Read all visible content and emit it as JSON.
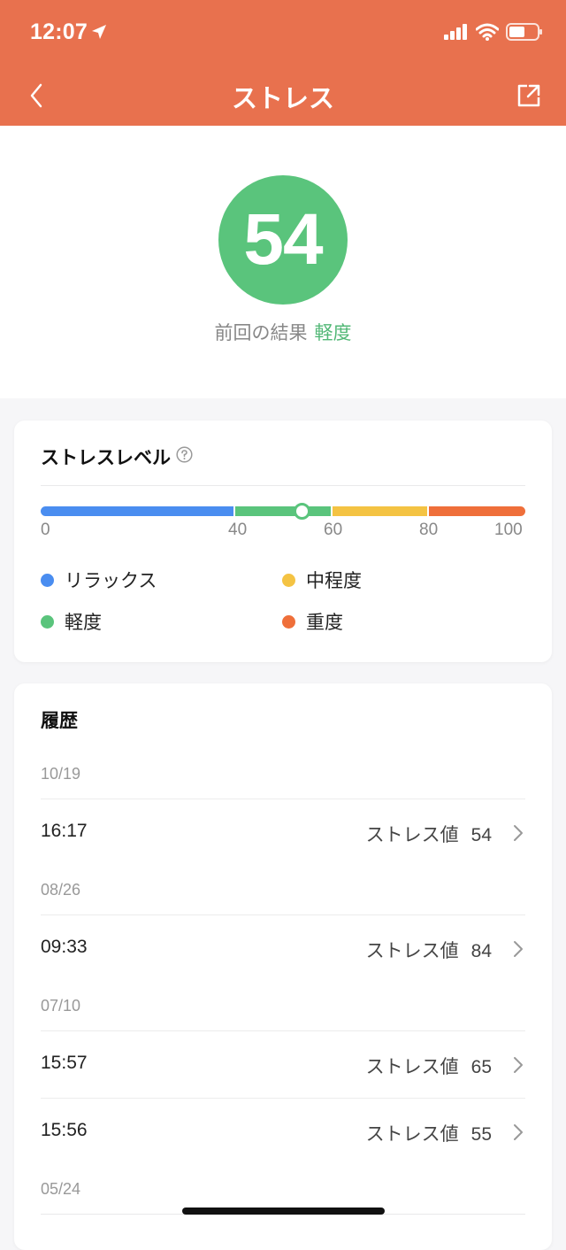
{
  "status_bar": {
    "time": "12:07"
  },
  "nav": {
    "title": "ストレス"
  },
  "summary": {
    "score": "54",
    "result_label": "前回の結果",
    "result_value": "軽度"
  },
  "stress_level": {
    "title": "ストレスレベル",
    "ticks": [
      "0",
      "40",
      "60",
      "80",
      "100"
    ],
    "current_value": 54,
    "segments": [
      {
        "from": 0,
        "to": 40,
        "color": "#4a8df0"
      },
      {
        "from": 40,
        "to": 60,
        "color": "#5ac47c"
      },
      {
        "from": 60,
        "to": 80,
        "color": "#f4c343"
      },
      {
        "from": 80,
        "to": 100,
        "color": "#ef6f3a"
      }
    ],
    "legend": [
      {
        "label": "リラックス",
        "color": "#4a8df0"
      },
      {
        "label": "中程度",
        "color": "#f4c343"
      },
      {
        "label": "軽度",
        "color": "#5ac47c"
      },
      {
        "label": "重度",
        "color": "#ef6f3a"
      }
    ]
  },
  "history": {
    "title": "履歴",
    "value_label": "ストレス値",
    "groups": [
      {
        "date": "10/19",
        "entries": [
          {
            "time": "16:17",
            "value": "54"
          }
        ]
      },
      {
        "date": "08/26",
        "entries": [
          {
            "time": "09:33",
            "value": "84"
          }
        ]
      },
      {
        "date": "07/10",
        "entries": [
          {
            "time": "15:57",
            "value": "65"
          },
          {
            "time": "15:56",
            "value": "55"
          }
        ]
      },
      {
        "date": "05/24",
        "entries": []
      }
    ]
  },
  "colors": {
    "header": "#e8714e",
    "accent_green": "#5ac47c"
  }
}
